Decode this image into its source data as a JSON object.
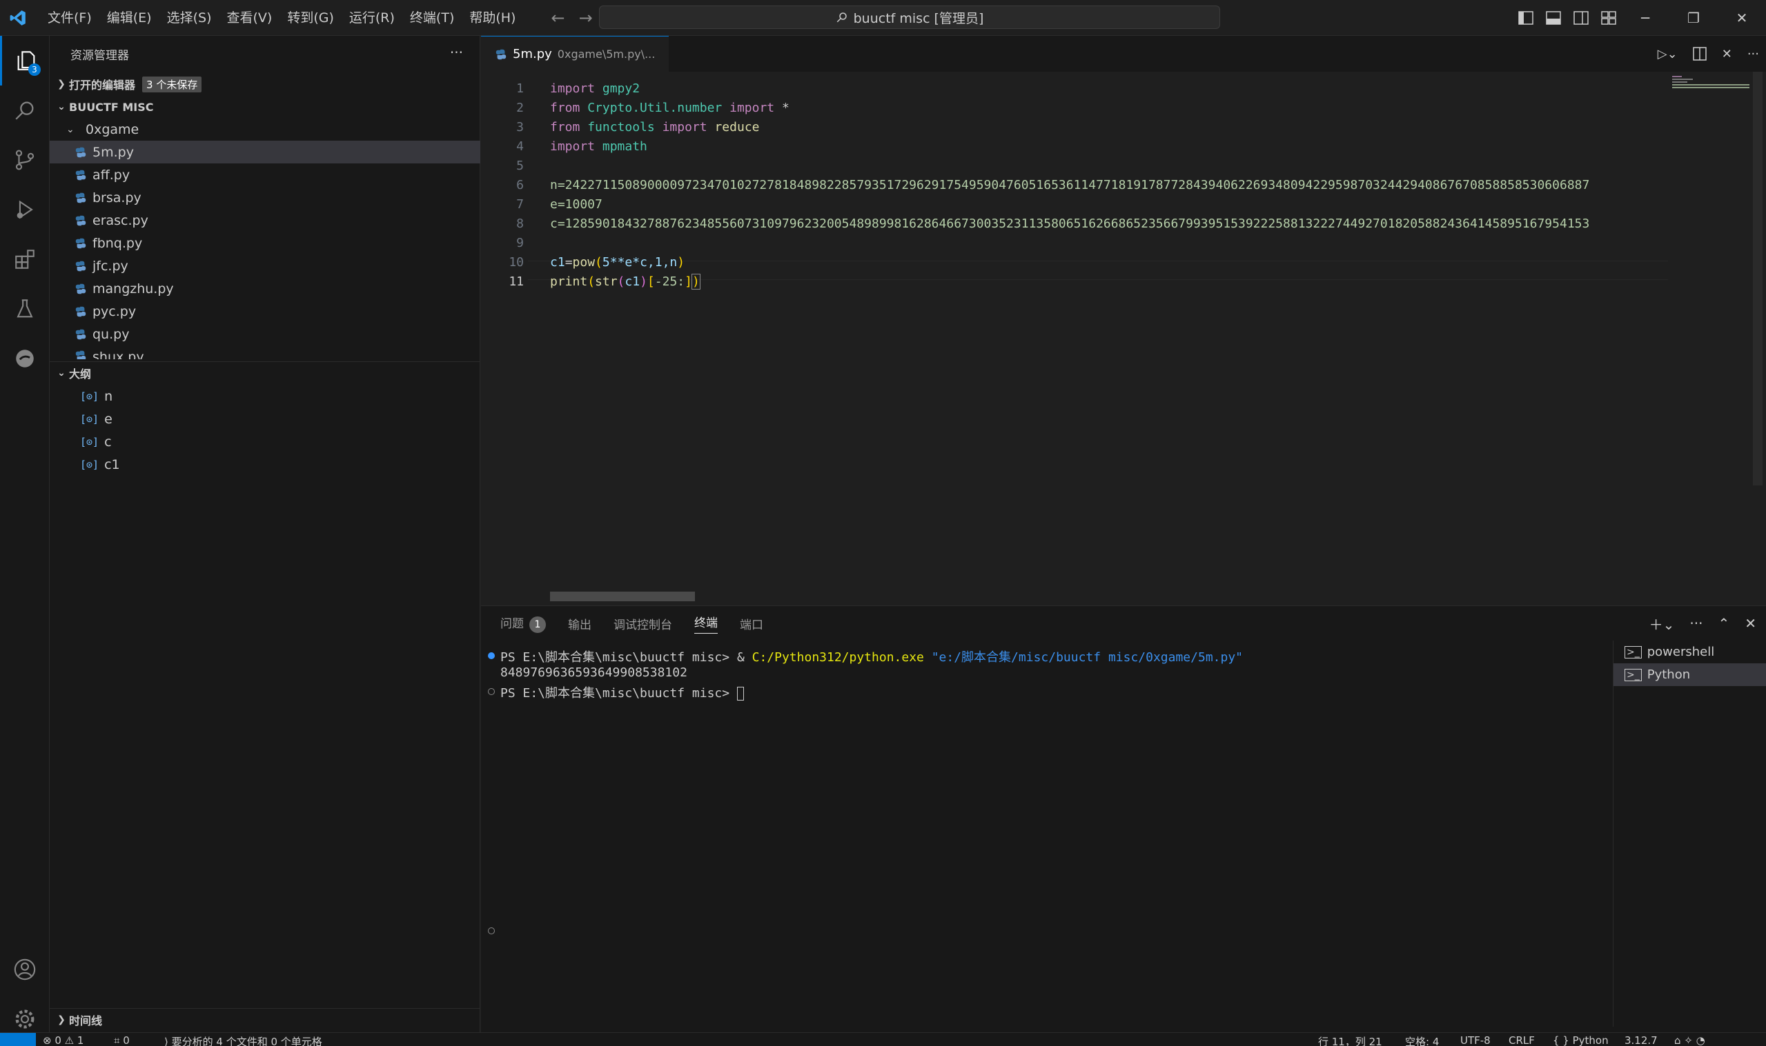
{
  "titlebar": {
    "menu": [
      "文件(F)",
      "编辑(E)",
      "选择(S)",
      "查看(V)",
      "转到(G)",
      "运行(R)",
      "终端(T)",
      "帮助(H)"
    ],
    "search_text": "buuctf misc [管理员]"
  },
  "activity": {
    "explorer_badge": "3"
  },
  "sidebar": {
    "title": "资源管理器",
    "more": "···",
    "open_editors": {
      "label": "打开的编辑器",
      "badge": "3 个未保存"
    },
    "workspace": "BUUCTF MISC",
    "folder": "0xgame",
    "files": [
      "5m.py",
      "aff.py",
      "brsa.py",
      "erasc.py",
      "fbnq.py",
      "jfc.py",
      "mangzhu.py",
      "pyc.py",
      "qu.py",
      "shux.py"
    ],
    "outline_title": "大纲",
    "outline": [
      "n",
      "e",
      "c",
      "c1"
    ],
    "timeline": "时间线"
  },
  "editor": {
    "tab_name": "5m.py",
    "tab_path": "0xgame\\5m.py\\...",
    "line_numbers": [
      "1",
      "2",
      "3",
      "4",
      "5",
      "6",
      "7",
      "8",
      "9",
      "10",
      "11"
    ],
    "code": {
      "l1_kw": "import",
      "l1_mod": "gmpy2",
      "l2_kw1": "from",
      "l2_mod": "Crypto.Util.number",
      "l2_kw2": "import",
      "l2_rest": "*",
      "l3_kw1": "from",
      "l3_mod": "functools",
      "l3_kw2": "import",
      "l3_rest": "reduce",
      "l4_kw": "import",
      "l4_mod": "mpmath",
      "l6": "n=24227115089000097234701027278184898228579351729629175495904760516536114771819178772843940622693480942295987032442940867670858858530606887",
      "l7": "e=10007",
      "l8": "c=12859018432788762348556073109796232005489899816286466730035231135806516266865235667993951539222588132227449270182058824364145895167954153",
      "l10_var": "c1",
      "l10_eq": "=",
      "l10_fn": "pow",
      "l10_args": "5**e*c,1,n",
      "l11_fn": "print",
      "l11_fn2": "str",
      "l11_var": "c1",
      "l11_idx": "-25:"
    }
  },
  "panel": {
    "tabs": [
      "问题",
      "输出",
      "调试控制台",
      "终端",
      "端口"
    ],
    "problems_badge": "1",
    "terminal": {
      "prompt1": "PS E:\\脚本合集\\misc\\buuctf misc> ",
      "amp": "& ",
      "exe": "C:/Python312/python.exe",
      "arg": " \"e:/脚本合集/misc/buuctf misc/0xgame/5m.py\"",
      "output": "8489769636593649908538102",
      "prompt2": "PS E:\\脚本合集\\misc\\buuctf misc> "
    },
    "terminals": [
      "powershell",
      "Python"
    ]
  },
  "statusbar": {
    "problems": "⊗ 0 ⚠ 1",
    "ports": "⌗ 0",
    "analysis": "⟩ 要分析的 4 个文件和 0 个单元格",
    "position": "行 11，列 21",
    "spaces": "空格: 4",
    "encoding": "UTF-8",
    "eol": "CRLF",
    "language": "{ } Python",
    "version": "3.12.7"
  },
  "colors": {
    "accent": "#0078d4",
    "background": "#1f1f1f",
    "sidebar": "#181818"
  }
}
